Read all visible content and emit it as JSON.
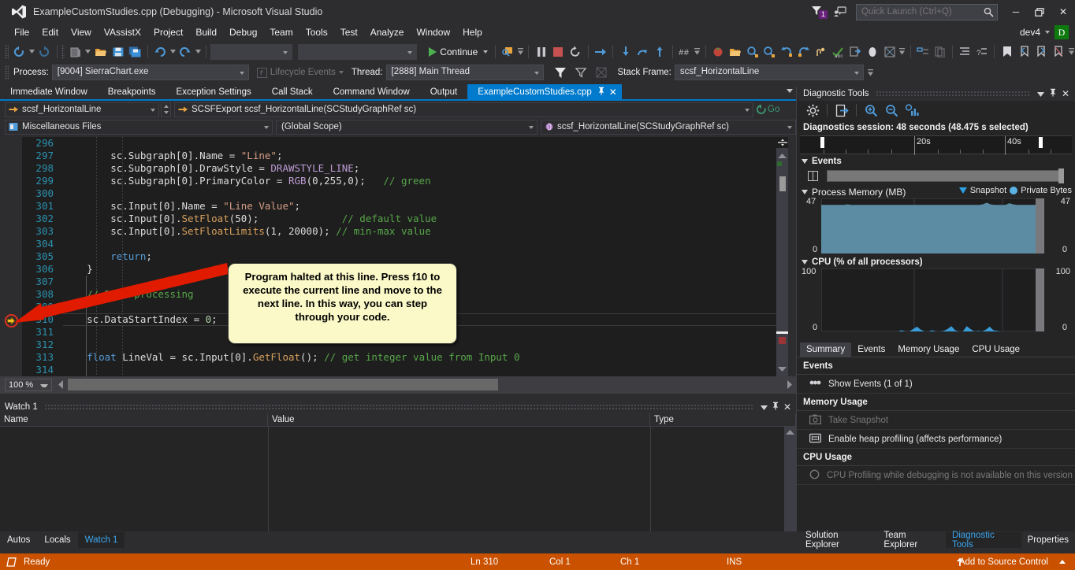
{
  "window": {
    "title": "ExampleCustomStudies.cpp (Debugging) - Microsoft Visual Studio",
    "notification_count": "1",
    "minimize_label": "─",
    "restore_label": "❐",
    "close_label": "✕",
    "user_name": "dev4",
    "avatar_letter": "D"
  },
  "quick_launch": {
    "placeholder": "Quick Launch (Ctrl+Q)",
    "value": ""
  },
  "menu": {
    "items": [
      "File",
      "Edit",
      "View",
      "VAssistX",
      "Project",
      "Build",
      "Debug",
      "Team",
      "Tools",
      "Test",
      "Analyze",
      "Window",
      "Help"
    ]
  },
  "toolbar": {
    "continue_label": "Continue",
    "combo1": "",
    "combo2": ""
  },
  "debug_bar": {
    "process_label": "Process:",
    "process_value": "[9004] SierraChart.exe",
    "lifecycle_label": "Lifecycle Events",
    "thread_label": "Thread:",
    "thread_value": "[2888] Main Thread",
    "stackframe_label": "Stack Frame:",
    "stackframe_value": "scsf_HorizontalLine"
  },
  "doc_tabs": {
    "items": [
      {
        "label": "Immediate Window",
        "active": false
      },
      {
        "label": "Breakpoints",
        "active": false
      },
      {
        "label": "Exception Settings",
        "active": false
      },
      {
        "label": "Call Stack",
        "active": false
      },
      {
        "label": "Command Window",
        "active": false
      },
      {
        "label": "Output",
        "active": false
      },
      {
        "label": "ExampleCustomStudies.cpp",
        "active": true
      }
    ]
  },
  "nav_bar": {
    "row1_left": "scsf_HorizontalLine",
    "row1_right": "SCSFExport scsf_HorizontalLine(SCStudyGraphRef sc)",
    "go_label": "Go",
    "row2_project": "Miscellaneous Files",
    "row2_scope": "(Global Scope)",
    "row2_member": "scsf_HorizontalLine(SCStudyGraphRef sc)"
  },
  "editor": {
    "zoom": "100 %",
    "current_line_number": 310,
    "lines": [
      {
        "num": 296,
        "tokens": []
      },
      {
        "num": 297,
        "tokens": [
          {
            "t": "plain",
            "s": "        sc.Subgraph[0].Name = "
          },
          {
            "t": "str",
            "s": "\"Line\""
          },
          {
            "t": "plain",
            "s": ";"
          }
        ]
      },
      {
        "num": 298,
        "tokens": [
          {
            "t": "plain",
            "s": "        sc.Subgraph[0].DrawStyle = "
          },
          {
            "t": "mac",
            "s": "DRAWSTYLE_LINE"
          },
          {
            "t": "plain",
            "s": ";"
          }
        ]
      },
      {
        "num": 299,
        "tokens": [
          {
            "t": "plain",
            "s": "        sc.Subgraph[0].PrimaryColor = "
          },
          {
            "t": "mac",
            "s": "RGB"
          },
          {
            "t": "plain",
            "s": "(0,255,0);   "
          },
          {
            "t": "com",
            "s": "// green"
          }
        ]
      },
      {
        "num": 300,
        "tokens": []
      },
      {
        "num": 301,
        "tokens": [
          {
            "t": "plain",
            "s": "        sc.Input[0].Name = "
          },
          {
            "t": "str",
            "s": "\"Line Value\""
          },
          {
            "t": "plain",
            "s": ";"
          }
        ]
      },
      {
        "num": 302,
        "tokens": [
          {
            "t": "plain",
            "s": "        sc.Input[0]."
          },
          {
            "t": "fn",
            "s": "SetFloat"
          },
          {
            "t": "plain",
            "s": "(50);              "
          },
          {
            "t": "com",
            "s": "// default value"
          }
        ]
      },
      {
        "num": 303,
        "tokens": [
          {
            "t": "plain",
            "s": "        sc.Input[0]."
          },
          {
            "t": "fn",
            "s": "SetFloatLimits"
          },
          {
            "t": "plain",
            "s": "(1, 20000); "
          },
          {
            "t": "com",
            "s": "// min-max value"
          }
        ]
      },
      {
        "num": 304,
        "tokens": []
      },
      {
        "num": 305,
        "tokens": [
          {
            "t": "kw",
            "s": "        return"
          },
          {
            "t": "plain",
            "s": ";"
          }
        ]
      },
      {
        "num": 306,
        "tokens": [
          {
            "t": "plain",
            "s": "    }"
          }
        ]
      },
      {
        "num": 307,
        "tokens": []
      },
      {
        "num": 308,
        "tokens": [
          {
            "t": "com",
            "s": "    // Data processing"
          }
        ]
      },
      {
        "num": 309,
        "tokens": []
      },
      {
        "num": 310,
        "tokens": [
          {
            "t": "plain",
            "s": "    sc.DataStartIndex = "
          },
          {
            "t": "num",
            "s": "0"
          },
          {
            "t": "plain",
            "s": ";"
          }
        ]
      },
      {
        "num": 311,
        "tokens": []
      },
      {
        "num": 312,
        "tokens": []
      },
      {
        "num": 313,
        "tokens": [
          {
            "t": "kw",
            "s": "    float"
          },
          {
            "t": "plain",
            "s": " LineVal = sc.Input[0]."
          },
          {
            "t": "fn",
            "s": "GetFloat"
          },
          {
            "t": "plain",
            "s": "(); "
          },
          {
            "t": "com",
            "s": "// get integer value from Input 0"
          }
        ]
      },
      {
        "num": 314,
        "tokens": []
      }
    ]
  },
  "callout": {
    "text": "Program halted at this line. Press f10 to execute the current line and move to the next line. In this way, you can step through your code.",
    "bg_color": "#fbf9c8",
    "arrow_color": "#e01b00"
  },
  "watch": {
    "title": "Watch 1",
    "columns": [
      "Name",
      "Value",
      "Type"
    ],
    "rows": []
  },
  "bottom_tabs": {
    "items": [
      {
        "label": "Autos",
        "active": false
      },
      {
        "label": "Locals",
        "active": false
      },
      {
        "label": "Watch 1",
        "active": true
      }
    ]
  },
  "diagnostics": {
    "title": "Diagnostic Tools",
    "session_text": "Diagnostics session: 48 seconds (48.475 s selected)",
    "timeline": {
      "labels": [
        "20s",
        "40s"
      ],
      "label_positions_pct": [
        41,
        74
      ]
    },
    "events": {
      "section_label": "Events"
    },
    "memory": {
      "section_label": "Process Memory (MB)",
      "legend": [
        "Snapshot",
        "Private Bytes"
      ],
      "y_max": "47",
      "y_min": "0",
      "fill_color": "#5b8ca4"
    },
    "cpu": {
      "section_label": "CPU (% of all processors)",
      "y_max": "100",
      "y_min": "0",
      "fill_color": "#3a9cd6"
    },
    "tabs": [
      {
        "label": "Summary",
        "active": true
      },
      {
        "label": "Events",
        "active": false
      },
      {
        "label": "Memory Usage",
        "active": false
      },
      {
        "label": "CPU Usage",
        "active": false
      }
    ],
    "summary": [
      {
        "group": "Events",
        "items": [
          {
            "label": "Show Events (1 of 1)",
            "icon": "events-icon",
            "disabled": false
          }
        ]
      },
      {
        "group": "Memory Usage",
        "items": [
          {
            "label": "Take Snapshot",
            "icon": "camera-icon",
            "disabled": true
          },
          {
            "label": "Enable heap profiling (affects performance)",
            "icon": "heap-icon",
            "disabled": false
          }
        ]
      },
      {
        "group": "CPU Usage",
        "items": [
          {
            "label": "CPU Profiling while debugging is not available on this version ·",
            "icon": "record-icon",
            "disabled": true
          }
        ]
      }
    ]
  },
  "right_tabs": {
    "items": [
      {
        "label": "Solution Explorer",
        "active": false
      },
      {
        "label": "Team Explorer",
        "active": false
      },
      {
        "label": "Diagnostic Tools",
        "active": true
      },
      {
        "label": "Properties",
        "active": false
      }
    ]
  },
  "status_bar": {
    "ready": "Ready",
    "line": "Ln 310",
    "col": "Col 1",
    "ch": "Ch 1",
    "ins": "INS",
    "source_control": "Add to Source Control",
    "bg_color": "#ca5100"
  },
  "chart_data": [
    {
      "type": "area",
      "title": "Process Memory (MB)",
      "ylabel": "MB",
      "ylim": [
        0,
        47
      ],
      "series": [
        {
          "name": "Private Bytes",
          "values": [
            44,
            44,
            44,
            44,
            44,
            44,
            44,
            44.5,
            44,
            44,
            44,
            44,
            44,
            44,
            44,
            44,
            44,
            44,
            44,
            44,
            44,
            44,
            44,
            44,
            44,
            44,
            44,
            44,
            44,
            44,
            44,
            44,
            44,
            44,
            44,
            44,
            44,
            44,
            44,
            44,
            44,
            44,
            44,
            44.5,
            46,
            44.5,
            44,
            44,
            44,
            44,
            45.5,
            44.5,
            44,
            44,
            44,
            44,
            44,
            44
          ]
        }
      ],
      "legend": [
        "Snapshot",
        "Private Bytes"
      ],
      "grid": true
    },
    {
      "type": "area",
      "title": "CPU (% of all processors)",
      "ylabel": "%",
      "ylim": [
        0,
        100
      ],
      "series": [
        {
          "name": "CPU",
          "values": [
            0,
            0,
            0,
            0,
            0,
            0,
            0,
            0,
            0,
            0,
            0,
            0,
            0,
            0,
            0,
            0,
            0,
            0,
            0,
            0,
            0,
            2,
            0,
            0,
            4,
            8,
            3,
            0,
            0,
            2,
            0,
            0,
            1,
            4,
            9,
            2,
            0,
            0,
            9,
            4,
            0,
            1,
            0,
            3,
            8,
            2,
            1,
            0,
            0,
            0,
            0,
            0,
            0,
            0,
            0,
            0,
            0
          ]
        }
      ],
      "grid": true
    }
  ]
}
